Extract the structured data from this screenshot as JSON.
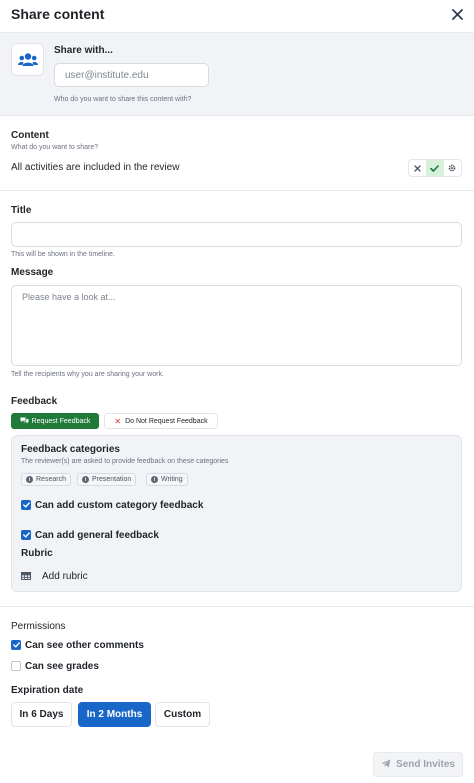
{
  "dialog": {
    "title": "Share content"
  },
  "share": {
    "heading": "Share with...",
    "email_placeholder": "user@institute.edu",
    "hint": "Who do you want to share this content with?"
  },
  "content": {
    "label": "Content",
    "hint": "What do you want to share?",
    "summary": "All activities are included in the review"
  },
  "title_field": {
    "label": "Title",
    "value": "",
    "hint": "This will be shown in the timeline."
  },
  "message": {
    "label": "Message",
    "placeholder": "Please have a look at...",
    "hint": "Tell the recipients why you are sharing your work."
  },
  "feedback": {
    "label": "Feedback",
    "request_label": "Request Feedback",
    "no_request_label": "Do Not Request Feedback",
    "categories_title": "Feedback categories",
    "categories_hint": "The reviewer(s) are asked to provide feedback on these categories",
    "categories": [
      "Research",
      "Presentation",
      "Writing"
    ],
    "custom_category_label": "Can add custom category feedback",
    "custom_category_checked": true,
    "general_feedback_label": "Can add general feedback",
    "general_feedback_checked": true,
    "rubric_label": "Rubric",
    "add_rubric_label": "Add rubric"
  },
  "permissions": {
    "label": "Permissions",
    "see_comments_label": "Can see other comments",
    "see_comments_checked": true,
    "see_grades_label": "Can see grades",
    "see_grades_checked": false
  },
  "expiration": {
    "label": "Expiration date",
    "options": [
      "In 6 Days",
      "In 2 Months",
      "Custom"
    ],
    "selected": "In 2 Months"
  },
  "actions": {
    "send_label": "Send Invites"
  },
  "colors": {
    "primary": "#1766c8",
    "success": "#1f7a3a",
    "panel_bg": "#f1f3f7",
    "danger": "#dd3333"
  },
  "icons": {
    "close": "close-icon",
    "users": "users-icon",
    "toggle_exclude": "x-icon",
    "toggle_include": "check-icon",
    "toggle_settings": "gear-icon",
    "request": "comments-icon",
    "info": "info-icon",
    "rubric": "table-icon",
    "send": "paper-plane-icon"
  }
}
